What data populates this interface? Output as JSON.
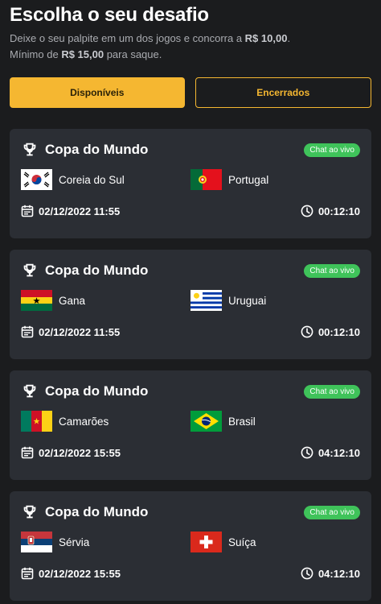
{
  "header": {
    "title": "Escolha o seu desafio",
    "subtitle_line1_pre": "Deixe o seu palpite em um dos jogos e concorra a ",
    "subtitle_line1_amount": "R$ 10,00",
    "subtitle_line1_post": ".",
    "subtitle_line2_pre": "Mínimo de ",
    "subtitle_line2_amount": "R$ 15,00",
    "subtitle_line2_post": " para saque."
  },
  "tabs": [
    {
      "label": "Disponíveis",
      "active": true
    },
    {
      "label": "Encerrados",
      "active": false
    }
  ],
  "colors": {
    "accent": "#f5b731",
    "card_bg": "#2b2e34",
    "page_bg": "#1b1c1e",
    "chat_badge": "#3fc35a"
  },
  "matches": [
    {
      "competition": "Copa do Mundo",
      "badge": "Chat ao vivo",
      "home": {
        "name": "Coreia do Sul",
        "flag": "south-korea-flag"
      },
      "away": {
        "name": "Portugal",
        "flag": "portugal-flag"
      },
      "date": "02/12/2022 11:55",
      "countdown": "00:12:10"
    },
    {
      "competition": "Copa do Mundo",
      "badge": "Chat ao vivo",
      "home": {
        "name": "Gana",
        "flag": "ghana-flag"
      },
      "away": {
        "name": "Uruguai",
        "flag": "uruguay-flag"
      },
      "date": "02/12/2022 11:55",
      "countdown": "00:12:10"
    },
    {
      "competition": "Copa do Mundo",
      "badge": "Chat ao vivo",
      "home": {
        "name": "Camarões",
        "flag": "cameroon-flag"
      },
      "away": {
        "name": "Brasil",
        "flag": "brazil-flag"
      },
      "date": "02/12/2022 15:55",
      "countdown": "04:12:10"
    },
    {
      "competition": "Copa do Mundo",
      "badge": "Chat ao vivo",
      "home": {
        "name": "Sérvia",
        "flag": "serbia-flag"
      },
      "away": {
        "name": "Suíça",
        "flag": "switzerland-flag"
      },
      "date": "02/12/2022 15:55",
      "countdown": "04:12:10"
    }
  ]
}
